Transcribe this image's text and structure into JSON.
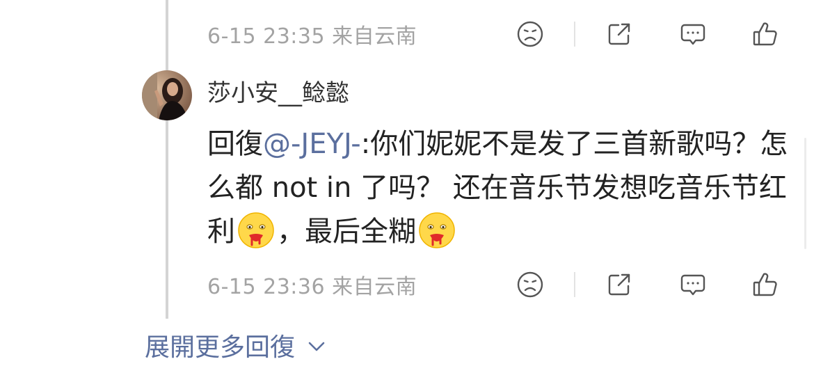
{
  "reply_above": {
    "meta": "6-15 23:35 来自云南",
    "icons": [
      "sad-face-icon",
      "share-icon",
      "comment-icon",
      "thumbs-up-icon"
    ]
  },
  "reply": {
    "username": "莎小安__鲶懿",
    "prefix": "回復",
    "mention": "@-JEYJ-",
    "text_part1": ":你们妮妮不是发了三首新歌吗？怎么都 not in 了吗？ 还在音乐节发想吃音乐节红利",
    "emoji1": "drooling-face-emoji",
    "text_part2": "，最后全糊",
    "emoji2": "drooling-face-emoji",
    "meta": "6-15 23:36 来自云南",
    "icons": [
      "sad-face-icon",
      "share-icon",
      "comment-icon",
      "thumbs-up-icon"
    ]
  },
  "expand_label": "展開更多回復",
  "colors": {
    "link": "#5b6f9e",
    "meta": "#a3a3a3",
    "body_text": "#222222",
    "thread_line": "#d4d4d4"
  }
}
